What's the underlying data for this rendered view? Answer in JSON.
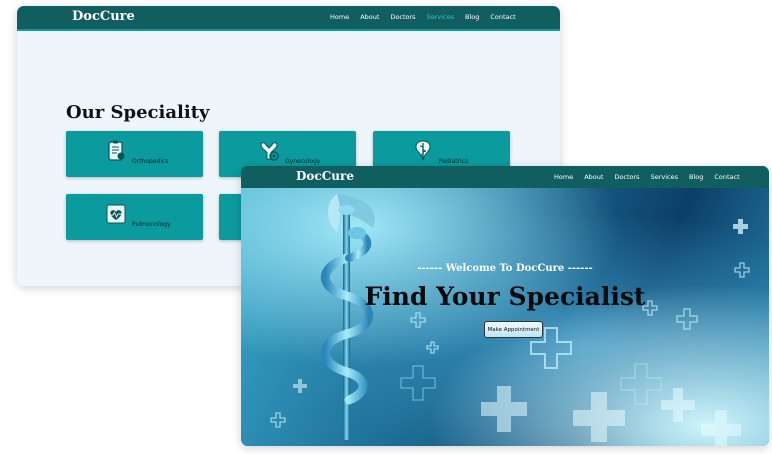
{
  "back_window": {
    "brand": "DocCure",
    "nav": [
      "Home",
      "About",
      "Doctors",
      "Services",
      "Blog",
      "Contact"
    ],
    "active_nav": "Services",
    "section_title": "Our Speciality",
    "cards": [
      {
        "label": "Orthopedics",
        "icon": "clipboard-icon"
      },
      {
        "label": "Gynecology",
        "icon": "uterus-icon"
      },
      {
        "label": "Pediatrics",
        "icon": "caduceus-icon"
      },
      {
        "label": "Pulmonology",
        "icon": "lungs-heart-icon"
      },
      {
        "label": "",
        "icon": ""
      },
      {
        "label": "",
        "icon": ""
      }
    ]
  },
  "front_window": {
    "brand": "DocCure",
    "nav": [
      "Home",
      "About",
      "Doctors",
      "Services",
      "Blog",
      "Contact"
    ],
    "welcome": "------ Welcome To DocCure ------",
    "headline": "Find Your Specialist",
    "button": "Make Appointment"
  },
  "colors": {
    "nav_bg": "#115e61",
    "card_bg": "#0b9a9e",
    "active_link": "#28c3d2",
    "page_bg": "#eef6fc"
  }
}
